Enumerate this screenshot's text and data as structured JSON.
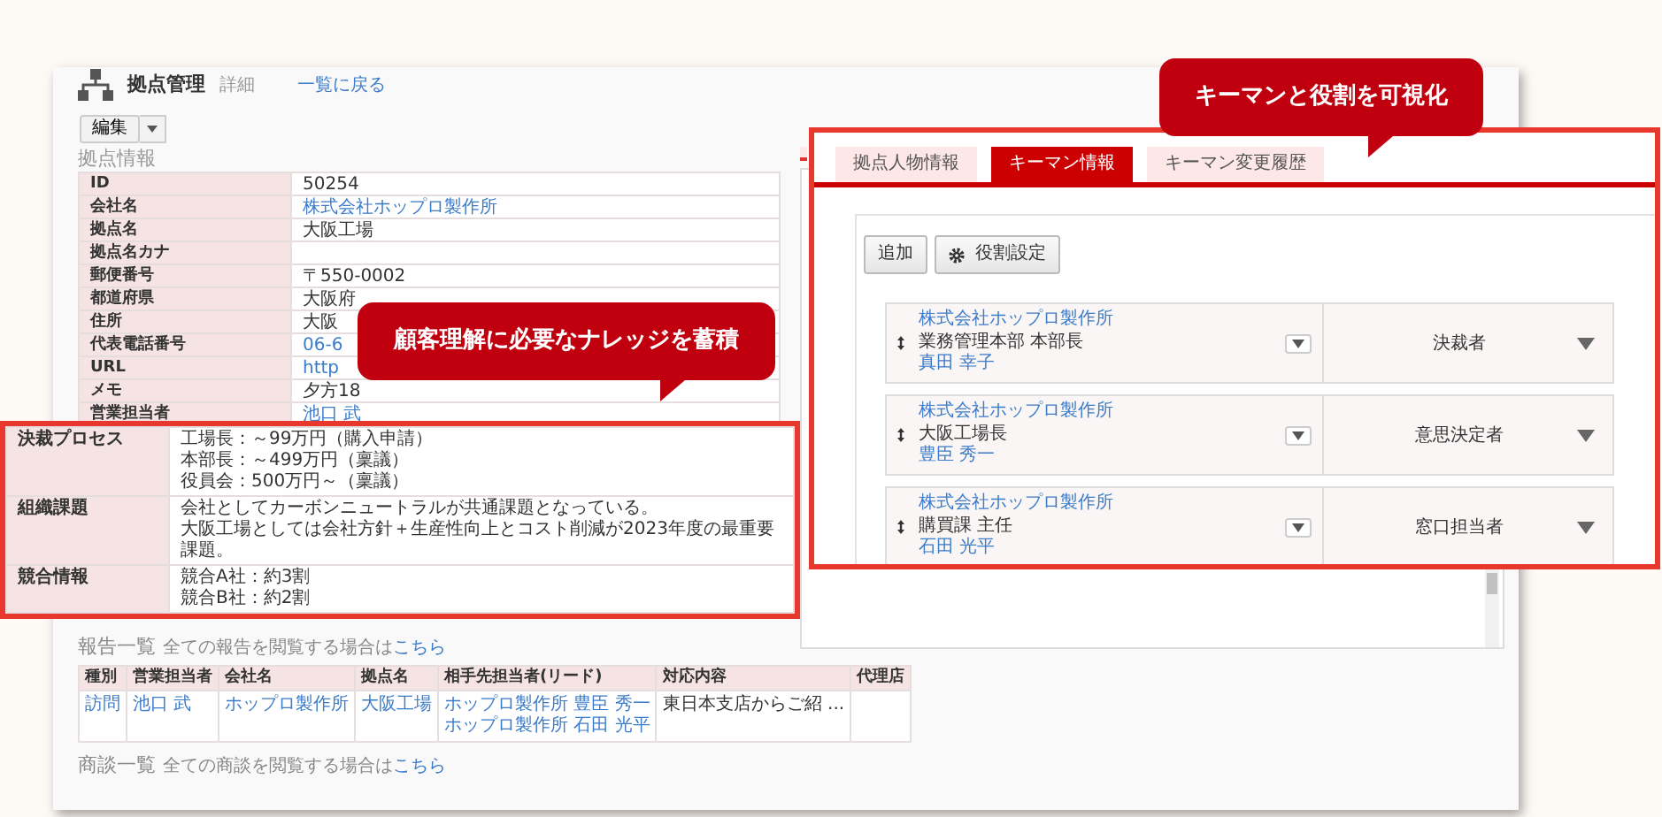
{
  "app_header": {
    "title": "拠点管理",
    "subtitle": "詳細",
    "back_link": "一覧に戻る"
  },
  "edit_button": "編集",
  "section_title": "拠点情報",
  "info_rows": [
    {
      "label": "ID",
      "value": "50254",
      "link": false
    },
    {
      "label": "会社名",
      "value": "株式会社ホップロ製作所",
      "link": true
    },
    {
      "label": "拠点名",
      "value": "大阪工場",
      "link": false
    },
    {
      "label": "拠点名カナ"
    },
    {
      "label": "郵便番号",
      "value": "〒550-0002",
      "link": false
    },
    {
      "label": "都道府県",
      "value": "大阪府",
      "link": false
    },
    {
      "label": "住所",
      "value": "大阪",
      "link": false
    },
    {
      "label": "代表電話番号",
      "value": "06-6",
      "link": true
    },
    {
      "label": "URL",
      "value": "http",
      "link": true
    },
    {
      "label": "メモ",
      "value": "夕方18",
      "link": false
    },
    {
      "label": "営業担当者",
      "value": "池口 武",
      "link": true
    }
  ],
  "knowledge_rows": [
    {
      "label": "決裁プロセス",
      "lines": [
        "工場長：～99万円（購入申請）",
        "本部長：～499万円（稟議）",
        "役員会：500万円～（稟議）"
      ]
    },
    {
      "label": "組織課題",
      "lines": [
        "会社としてカーボンニュートラルが共通課題となっている。",
        "大阪工場としては会社方針＋生産性向上とコスト削減が2023年度の最重要課題。"
      ]
    },
    {
      "label": "競合情報",
      "lines": [
        "競合A社：約3割",
        "競合B社：約2割"
      ]
    }
  ],
  "reports": {
    "title": "報告一覧",
    "note": "全ての報告を閲覧する場合は",
    "note_link": "こちら",
    "columns": [
      "種別",
      "営業担当者",
      "会社名",
      "拠点名",
      "相手先担当者(リード)",
      "対応内容",
      "代理店"
    ],
    "rows": [
      {
        "cells": [
          {
            "lines": [
              "訪問"
            ],
            "link": true
          },
          {
            "lines": [
              "池口 武"
            ],
            "link": true
          },
          {
            "lines": [
              "ホップロ製作所"
            ],
            "link": true
          },
          {
            "lines": [
              "大阪工場"
            ],
            "link": true
          },
          {
            "lines": [
              "ホップロ製作所 豊臣 秀一",
              "ホップロ製作所 石田 光平"
            ],
            "link": true
          },
          {
            "lines": [
              "東日本支店からご紹 ..."
            ],
            "link": false
          },
          {}
        ]
      }
    ]
  },
  "deals": {
    "title": "商談一覧",
    "note": "全ての商談を閲覧する場合は",
    "note_link": "こちら"
  },
  "keyman_panel": {
    "tabs": [
      {
        "label": "拠点人物情報",
        "selected": false
      },
      {
        "label": "キーマン情報",
        "selected": true
      },
      {
        "label": "キーマン変更履歴",
        "selected": false
      }
    ],
    "buttons": [
      {
        "label": "追加",
        "icon": false
      },
      {
        "label": "役割設定",
        "icon": true
      }
    ],
    "people": [
      {
        "company": "株式会社ホップロ製作所",
        "title": "業務管理本部 本部長",
        "name": "真田 幸子",
        "role": "決裁者"
      },
      {
        "company": "株式会社ホップロ製作所",
        "title": "大阪工場長",
        "name": "豊臣 秀一",
        "role": "意思決定者"
      },
      {
        "company": "株式会社ホップロ製作所",
        "title": "購買課 主任",
        "name": "石田 光平",
        "role": "窓口担当者"
      }
    ]
  },
  "callouts": [
    {
      "text": "顧客理解に必要なナレッジを蓄積"
    },
    {
      "text": "キーマンと役割を可視化"
    }
  ]
}
